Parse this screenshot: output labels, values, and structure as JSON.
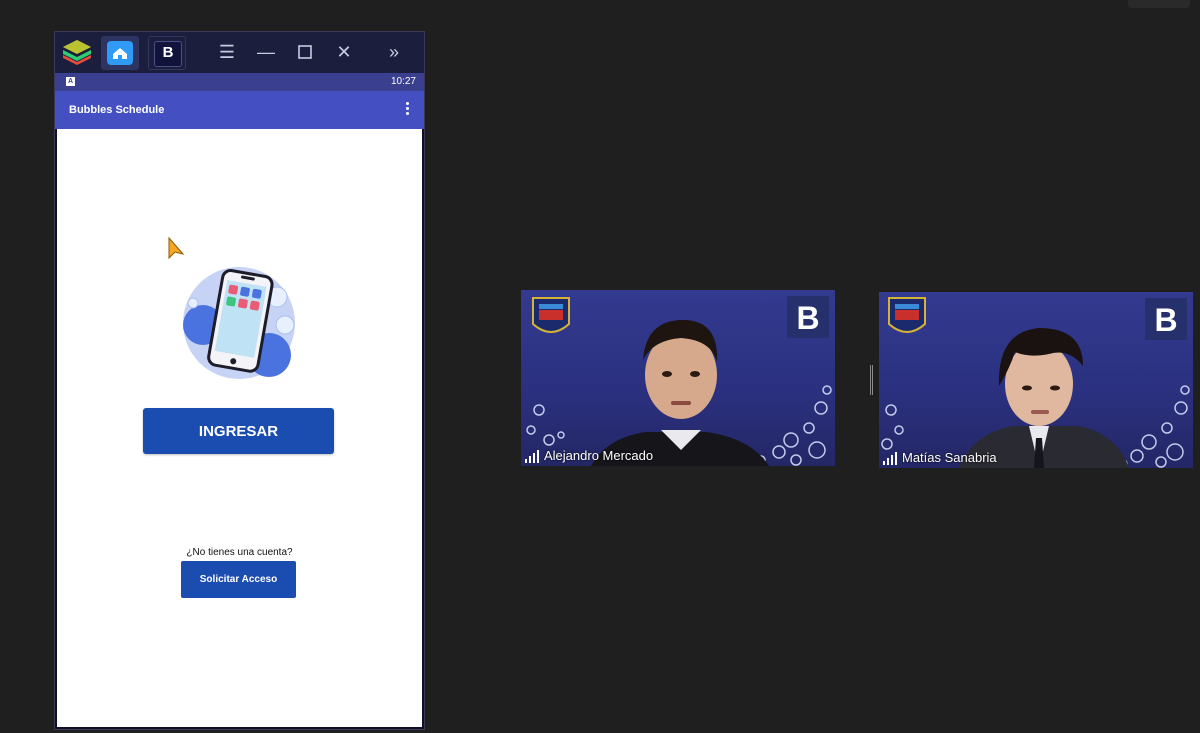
{
  "emulator": {
    "status_time": "10:27",
    "app_title": "Bubbles Schedule",
    "app_tab_letter": "B"
  },
  "login": {
    "ingresar_label": "INGRESAR",
    "no_account_text": "¿No tienes una cuenta?",
    "request_access_label": "Solicitar Acceso"
  },
  "participants": [
    {
      "name": "Alejandro Mercado"
    },
    {
      "name": "Matías Sanabria"
    }
  ],
  "colors": {
    "primary_button": "#1b4cb0",
    "app_bar": "#4450c1",
    "status_bar": "#3a3f90",
    "background": "#1f1f1f"
  }
}
